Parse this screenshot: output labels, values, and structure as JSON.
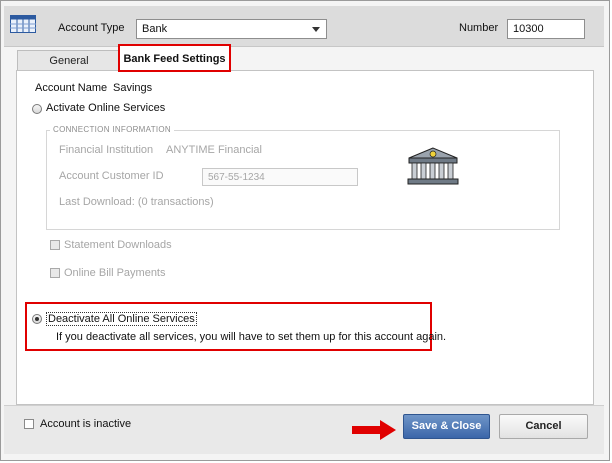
{
  "header": {
    "account_type_label": "Account Type",
    "account_type_value": "Bank",
    "number_label": "Number",
    "number_value": "10300"
  },
  "tabs": [
    {
      "label": "General",
      "selected": false
    },
    {
      "label": "Bank Feed Settings",
      "selected": true
    }
  ],
  "bank_feed": {
    "account_name_label": "Account Name",
    "account_name_value": "Savings",
    "activate_label": "Activate Online Services",
    "connection_info_legend": "CONNECTION INFORMATION",
    "financial_institution_label": "Financial Institution",
    "financial_institution_value": "ANYTIME Financial",
    "customer_id_label": "Account Customer ID",
    "customer_id_value": "567-55-1234",
    "last_download": "Last Download: (0 transactions)",
    "statement_downloads_label": "Statement Downloads",
    "online_bill_payments_label": "Online Bill Payments",
    "deactivate_label": "Deactivate All Online Services",
    "deactivate_note": "If you deactivate all services, you will have to set them up for this account again."
  },
  "footer": {
    "inactive_label": "Account is inactive",
    "save_close_label": "Save & Close",
    "cancel_label": "Cancel"
  },
  "colors": {
    "highlight_red": "#e00000",
    "primary_button": "#3b66a9"
  },
  "icons": [
    "ledger-icon",
    "dropdown-arrow-icon",
    "bank-building-icon",
    "red-arrow-icon"
  ]
}
